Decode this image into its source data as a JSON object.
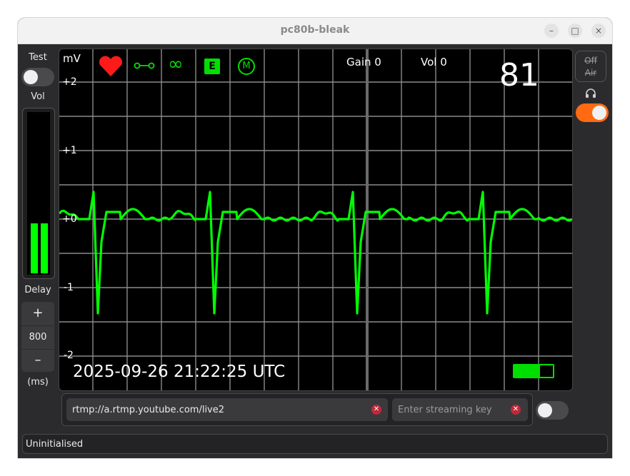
{
  "window": {
    "title": "pc80b-bleak",
    "minimize_glyph": "–",
    "maximize_glyph": "□",
    "close_glyph": "×"
  },
  "left_panel": {
    "test_label": "Test",
    "test_toggle_on": false,
    "vol_label": "Vol",
    "vol_levels": [
      0.32,
      0.32
    ],
    "delay_label": "Delay",
    "increment_glyph": "+",
    "delay_value": "800",
    "decrement_glyph": "–",
    "unit_label": "(ms)"
  },
  "ecg": {
    "unit_label": "mV",
    "y_ticks": [
      "+2",
      "+1",
      "+0",
      "-1",
      "-2"
    ],
    "gain_label": "Gain 0",
    "vol_label": "Vol 0",
    "heart_rate": "81",
    "timestamp": "2025-09-26 21:22:25 UTC",
    "battery_level": 0.67,
    "trace_color": "#00ff00",
    "status_icons": [
      "heart-icon",
      "lead-connected-icon",
      "continuous-icon",
      "e-mode-icon",
      "m-mode-icon"
    ],
    "e_icon_letter": "E",
    "m_icon_letter": "M"
  },
  "right_panel": {
    "off_air_line1": "Off",
    "off_air_line2": "Air",
    "audio_icon": "headphones-icon",
    "audio_toggle_on": true,
    "accent_color": "#ff6a13"
  },
  "stream": {
    "url_value": "rtmp://a.rtmp.youtube.com/live2",
    "key_value": "",
    "key_placeholder": "Enter streaming key",
    "stream_toggle_on": false
  },
  "status_bar": {
    "text": "Uninitialised"
  }
}
